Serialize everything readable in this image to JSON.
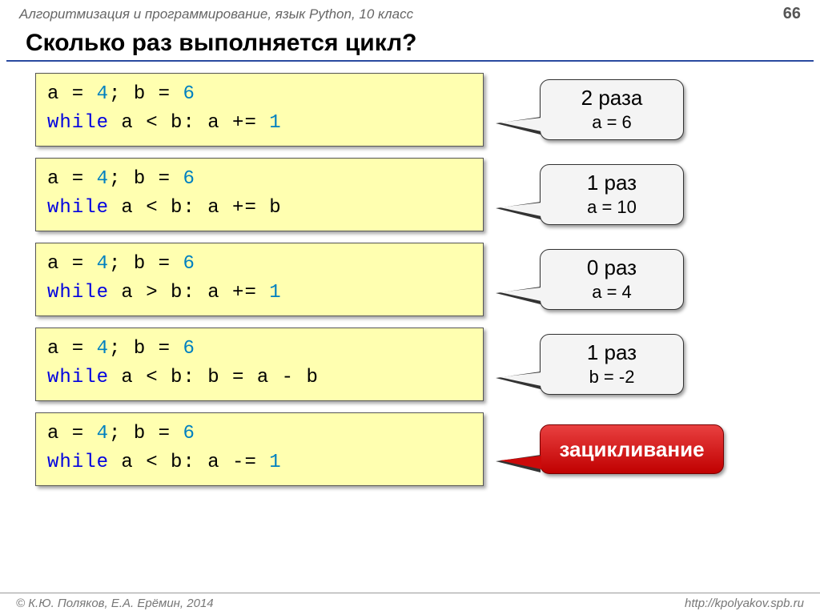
{
  "header": {
    "subject": "Алгоритмизация и программирование, язык Python, 10 класс",
    "page": "66"
  },
  "title": "Сколько раз выполняется цикл?",
  "examples": [
    {
      "code": {
        "init_a": "4",
        "init_b": "6",
        "cond": "a < b",
        "stmt": "a += ",
        "stmt_num": "1"
      },
      "answer": {
        "line1": "2 раза",
        "line2": "a = 6",
        "kind": "normal"
      }
    },
    {
      "code": {
        "init_a": "4",
        "init_b": "6",
        "cond": "a < b",
        "stmt": "a += b",
        "stmt_num": ""
      },
      "answer": {
        "line1": "1 раз",
        "line2": "a = 10",
        "kind": "normal"
      }
    },
    {
      "code": {
        "init_a": "4",
        "init_b": "6",
        "cond": "a > b",
        "stmt": "a += ",
        "stmt_num": "1"
      },
      "answer": {
        "line1": "0 раз",
        "line2": "a = 4",
        "kind": "normal"
      }
    },
    {
      "code": {
        "init_a": "4",
        "init_b": "6",
        "cond": "a < b",
        "stmt": "b = a - b",
        "stmt_num": ""
      },
      "answer": {
        "line1": "1 раз",
        "line2": "b = -2",
        "kind": "normal"
      }
    },
    {
      "code": {
        "init_a": "4",
        "init_b": "6",
        "cond": "a < b",
        "stmt": "a -= ",
        "stmt_num": "1"
      },
      "answer": {
        "line1": "зацикливание",
        "line2": "",
        "kind": "red"
      }
    }
  ],
  "footer": {
    "left": "© К.Ю. Поляков, Е.А. Ерёмин, 2014",
    "right": "http://kpolyakov.spb.ru"
  },
  "tokens": {
    "a_eq": "a = ",
    "b_eq": "; b = ",
    "while": "while ",
    "colon": ": "
  }
}
